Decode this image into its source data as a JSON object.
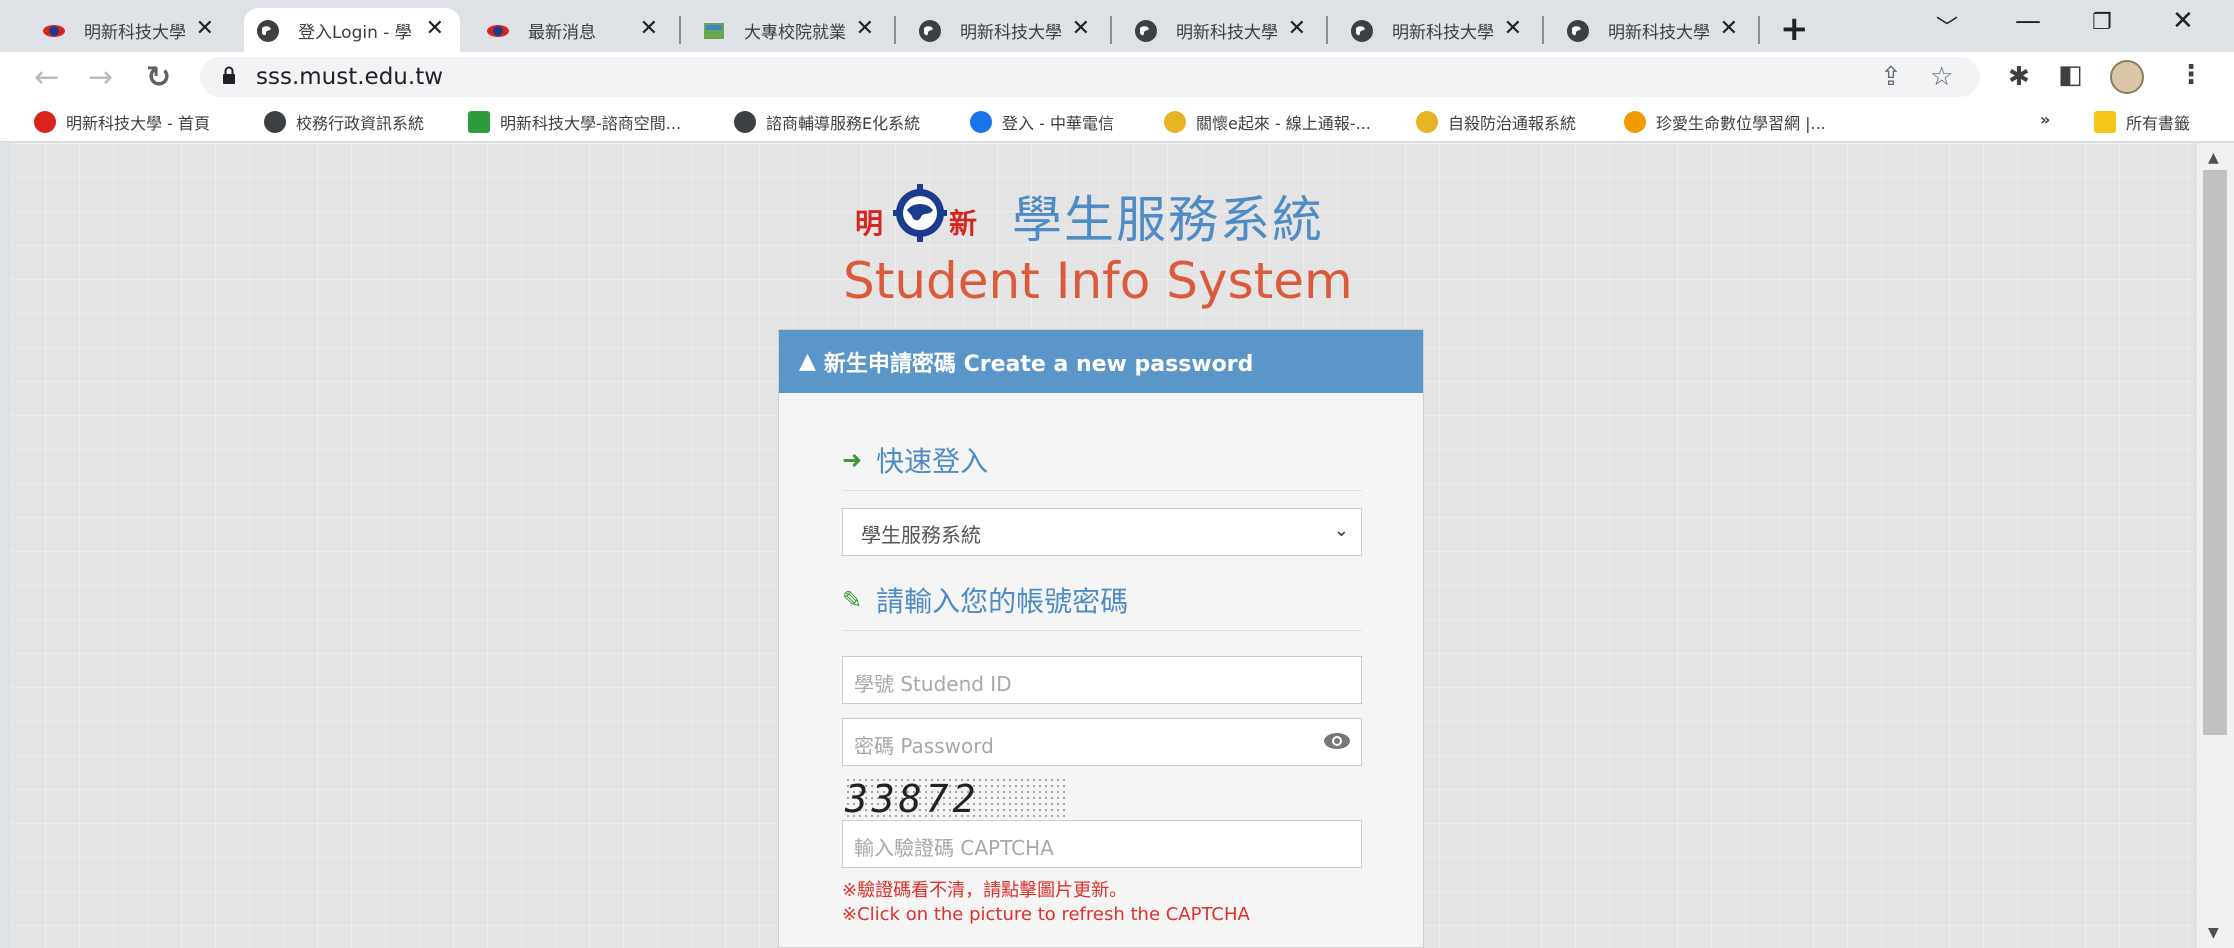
{
  "browser": {
    "tabs": [
      {
        "title": "明新科技大學",
        "active": false
      },
      {
        "title": "登入Login - 學",
        "active": true
      },
      {
        "title": "最新消息",
        "active": false
      },
      {
        "title": "大專校院就業",
        "active": false
      },
      {
        "title": "明新科技大學",
        "active": false
      },
      {
        "title": "明新科技大學",
        "active": false
      },
      {
        "title": "明新科技大學",
        "active": false
      },
      {
        "title": "明新科技大學",
        "active": false
      }
    ],
    "url": "sss.must.edu.tw",
    "bookmarks": [
      {
        "label": "明新科技大學 - 首頁",
        "color": "#d8231e"
      },
      {
        "label": "校務行政資訊系統",
        "color": "#3c4043"
      },
      {
        "label": "明新科技大學-諮商空間...",
        "color": "#2e9b3c"
      },
      {
        "label": "諮商輔導服務E化系統",
        "color": "#3c4043"
      },
      {
        "label": "登入 - 中華電信",
        "color": "#1a73e8"
      },
      {
        "label": "關懷e起來 - 線上通報-...",
        "color": "#e6b422"
      },
      {
        "label": "自殺防治通報系統",
        "color": "#e6b422"
      },
      {
        "label": "珍愛生命數位學習網 |...",
        "color": "#f29b00"
      }
    ],
    "more_bookmarks": "»",
    "all_bookmarks": "所有書籤"
  },
  "header": {
    "logo_left": "明",
    "logo_right": "新",
    "system_name_zh": "學生服務系統",
    "system_name_en": "Student Info System"
  },
  "panel": {
    "banner": "新生申請密碼 Create a new password",
    "quick_login_title": "快速登入",
    "system_select_value": "學生服務系統",
    "credentials_title": "請輸入您的帳號密碼",
    "student_id_placeholder": "學號 Studend ID",
    "password_placeholder": "密碼 Password",
    "captcha_text": "33872",
    "captcha_placeholder": "輸入驗證碼 CAPTCHA",
    "captcha_note_zh": "※驗證碼看不清，請點擊圖片更新。",
    "captcha_note_en": "※Click on the picture to refresh the CAPTCHA"
  },
  "colors": {
    "banner_bg": "#5a97c8",
    "title_blue": "#4f8bc4",
    "title_red": "#dc5a3c",
    "note_red": "#e0302a",
    "icon_green": "#3c9a3a"
  }
}
